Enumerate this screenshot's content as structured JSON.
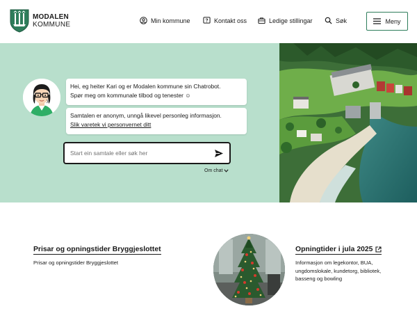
{
  "header": {
    "logo_line1": "MODALEN",
    "logo_line2": "KOMMUNE",
    "nav": [
      {
        "label": "Min kommune",
        "icon": "user-circle-icon"
      },
      {
        "label": "Kontakt oss",
        "icon": "chat-question-icon"
      },
      {
        "label": "Ledige stillingar",
        "icon": "briefcase-icon"
      },
      {
        "label": "Søk",
        "icon": "search-icon"
      }
    ],
    "menu_label": "Meny"
  },
  "chat": {
    "greeting_line1": "Hei, eg heiter Kari og er Modalen kommune sin Chatrobot.",
    "greeting_line2": "Spør meg om kommunale tilbod og tenester ☺",
    "privacy_text": "Samtalen er anonym, unngå likevel personleg informasjon.",
    "privacy_link": "Slik varetek vi personvernet ditt",
    "input_placeholder": "Start ein samtale eller søk her",
    "about_label": "Om chat"
  },
  "cards": [
    {
      "title": "Prisar og opningstider Bryggjeslottet",
      "description": "Prisar og opningstider Bryggjeslottet"
    },
    {
      "title": "Opningtider i jula 2025",
      "description": "Informasjon om legekontor, BUA, ungdomslokale, kundetorg, bibliotek, basseng og bowling"
    }
  ],
  "colors": {
    "hero_bg": "#b8dfcc",
    "brand_green": "#2e7d5b",
    "text": "#1a1a1a"
  }
}
